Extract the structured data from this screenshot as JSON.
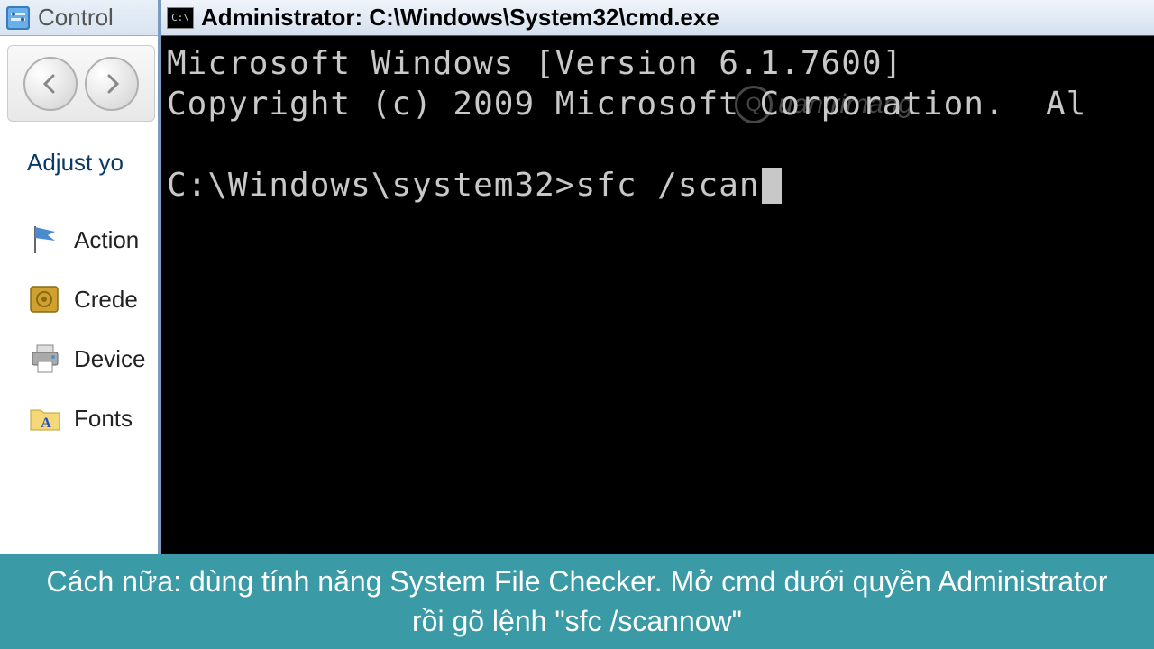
{
  "control_panel": {
    "title": "Control",
    "heading": "Adjust yo",
    "items": [
      {
        "label": "Action",
        "icon": "flag"
      },
      {
        "label": "Crede",
        "icon": "vault"
      },
      {
        "label": "Device",
        "icon": "printer"
      },
      {
        "label": "Fonts",
        "icon": "folder-font"
      }
    ]
  },
  "cmd": {
    "title": "Administrator: C:\\Windows\\System32\\cmd.exe",
    "line1": "Microsoft Windows [Version 6.1.7600]",
    "line2": "Copyright (c) 2009 Microsoft Corporation.  Al",
    "prompt": "C:\\Windows\\system32>",
    "command": "sfc /scan"
  },
  "watermark": "uantrimang",
  "caption": "Cách nữa: dùng tính năng System File Checker. Mở cmd dưới quyền Administrator rồi gõ lệnh \"sfc /scannow\""
}
